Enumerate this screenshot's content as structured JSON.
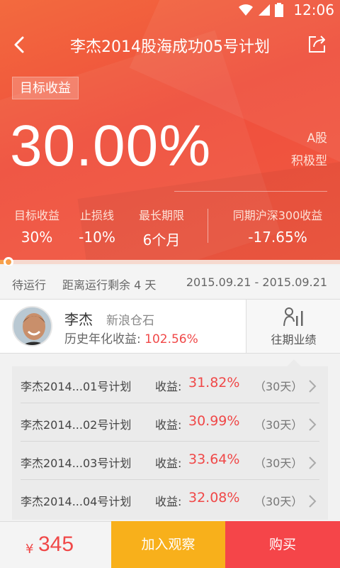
{
  "status_bar": {
    "time": "12:06"
  },
  "nav": {
    "title": "李杰2014股海成功05号计划"
  },
  "hero": {
    "tag": "目标收益",
    "rate": "30.00%",
    "market": "A股",
    "style": "积极型"
  },
  "stats": [
    {
      "label": "目标收益",
      "value": "30%"
    },
    {
      "label": "止损线",
      "value": "-10%"
    },
    {
      "label": "最长期限",
      "value": "6个月"
    },
    {
      "label": "同期沪深300收益",
      "value": "-17.65%"
    }
  ],
  "progress": {
    "fraction": 0.02
  },
  "info": {
    "status": "待运行",
    "remaining": "距离运行剩余 4 天",
    "date_range": "2015.09.21 - 2015.09.21"
  },
  "manager": {
    "name": "李杰",
    "firm": "新浪仓石",
    "history_label": "历史年化收益: ",
    "history_value": "102.56%",
    "past_button": "往期业绩"
  },
  "plans": [
    {
      "name": "李杰2014...01号计划",
      "label": "收益:",
      "value": "31.82%",
      "days": "（30天）"
    },
    {
      "name": "李杰2014...02号计划",
      "label": "收益:",
      "value": "30.99%",
      "days": "（30天）"
    },
    {
      "name": "李杰2014...03号计划",
      "label": "收益:",
      "value": "33.64%",
      "days": "（30天）"
    },
    {
      "name": "李杰2014...04号计划",
      "label": "收益:",
      "value": "32.08%",
      "days": "（30天）"
    }
  ],
  "bottom": {
    "currency": "¥",
    "price": "345",
    "watch_label": "加入观察",
    "buy_label": "购买"
  },
  "colors": {
    "accent_red": "#f04848",
    "hero_orange": "#ef4f3c",
    "watch_yellow": "#f8b01b",
    "buy_red": "#f54549"
  },
  "icons": [
    "wifi-icon",
    "signal-icon",
    "battery-icon",
    "back-arrow-icon",
    "share-icon",
    "chart-person-icon",
    "chevron-right-icon"
  ]
}
